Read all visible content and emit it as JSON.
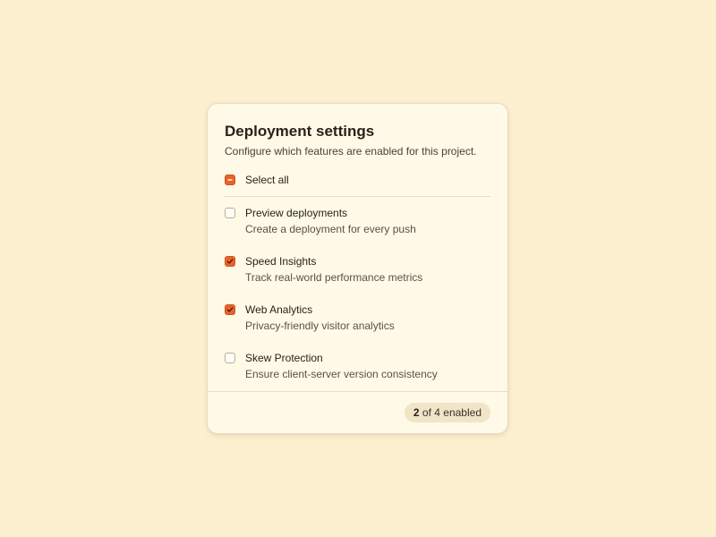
{
  "card": {
    "title": "Deployment settings",
    "subtitle": "Configure which features are enabled for this project."
  },
  "select_all": {
    "label": "Select all",
    "state": "indeterminate"
  },
  "features": [
    {
      "title": "Preview deployments",
      "description": "Create a deployment for every push",
      "checked": false
    },
    {
      "title": "Speed Insights",
      "description": "Track real-world performance metrics",
      "checked": true
    },
    {
      "title": "Web Analytics",
      "description": "Privacy-friendly visitor analytics",
      "checked": true
    },
    {
      "title": "Skew Protection",
      "description": "Ensure client-server version consistency",
      "checked": false
    }
  ],
  "footer": {
    "enabled_count": "2",
    "enabled_suffix": " of 4 enabled"
  },
  "colors": {
    "accent": "#e8622c",
    "background": "#fdf0d0",
    "card": "#fff9e8"
  }
}
